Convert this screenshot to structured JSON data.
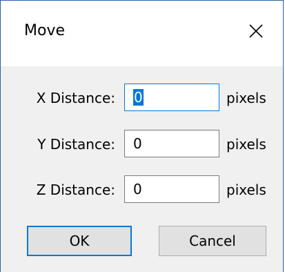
{
  "window": {
    "title": "Move",
    "close_glyph": "close-icon"
  },
  "fields": [
    {
      "label": "X Distance:",
      "value": "0",
      "unit": "pixels"
    },
    {
      "label": "Y Distance:",
      "value": "0",
      "unit": "pixels"
    },
    {
      "label": "Z Distance:",
      "value": "0",
      "unit": "pixels"
    }
  ],
  "buttons": {
    "ok_label": "OK",
    "cancel_label": "Cancel"
  },
  "colors": {
    "accent": "#0078d7",
    "frame": "#2b5fa8",
    "dialog_bg": "#f0f0f0"
  }
}
